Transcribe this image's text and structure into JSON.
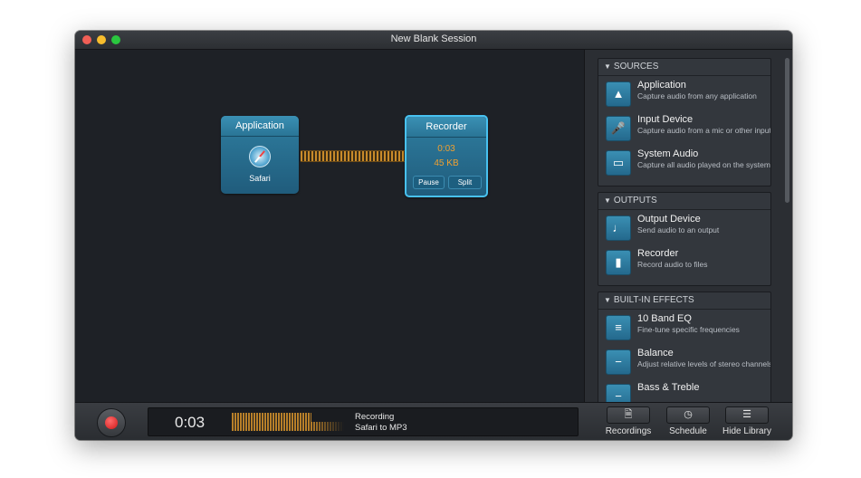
{
  "window": {
    "title": "New Blank Session"
  },
  "canvas": {
    "source_node": {
      "header": "Application",
      "label": "Safari",
      "icon": "safari-icon"
    },
    "recorder_node": {
      "header": "Recorder",
      "time": "0:03",
      "size": "45 KB",
      "pause_label": "Pause",
      "split_label": "Split"
    }
  },
  "sidebar": {
    "sources": {
      "heading": "SOURCES",
      "items": [
        {
          "title": "Application",
          "desc": "Capture audio from any application",
          "icon": "app-store-icon"
        },
        {
          "title": "Input Device",
          "desc": "Capture audio from a mic or other input",
          "icon": "microphone-icon"
        },
        {
          "title": "System Audio",
          "desc": "Capture all audio played on the system",
          "icon": "monitor-icon"
        }
      ]
    },
    "outputs": {
      "heading": "OUTPUTS",
      "items": [
        {
          "title": "Output Device",
          "desc": "Send audio to an output",
          "icon": "speaker-icon"
        },
        {
          "title": "Recorder",
          "desc": "Record audio to files",
          "icon": "file-icon"
        }
      ]
    },
    "effects": {
      "heading": "BUILT-IN EFFECTS",
      "items": [
        {
          "title": "10 Band EQ",
          "desc": "Fine-tune specific frequencies",
          "icon": "eq-sliders-icon"
        },
        {
          "title": "Balance",
          "desc": "Adjust relative levels of stereo channels",
          "icon": "balance-slider-icon"
        },
        {
          "title": "Bass & Treble",
          "desc": "",
          "icon": "bass-treble-icon"
        }
      ]
    }
  },
  "bottombar": {
    "time": "0:03",
    "status_line1": "Recording",
    "status_line2": "Safari to MP3",
    "recordings_label": "Recordings",
    "schedule_label": "Schedule",
    "hide_library_label": "Hide Library"
  },
  "colors": {
    "accent": "#2f7ea0",
    "record_red": "#d01818",
    "meter_orange": "#c88a2a"
  }
}
